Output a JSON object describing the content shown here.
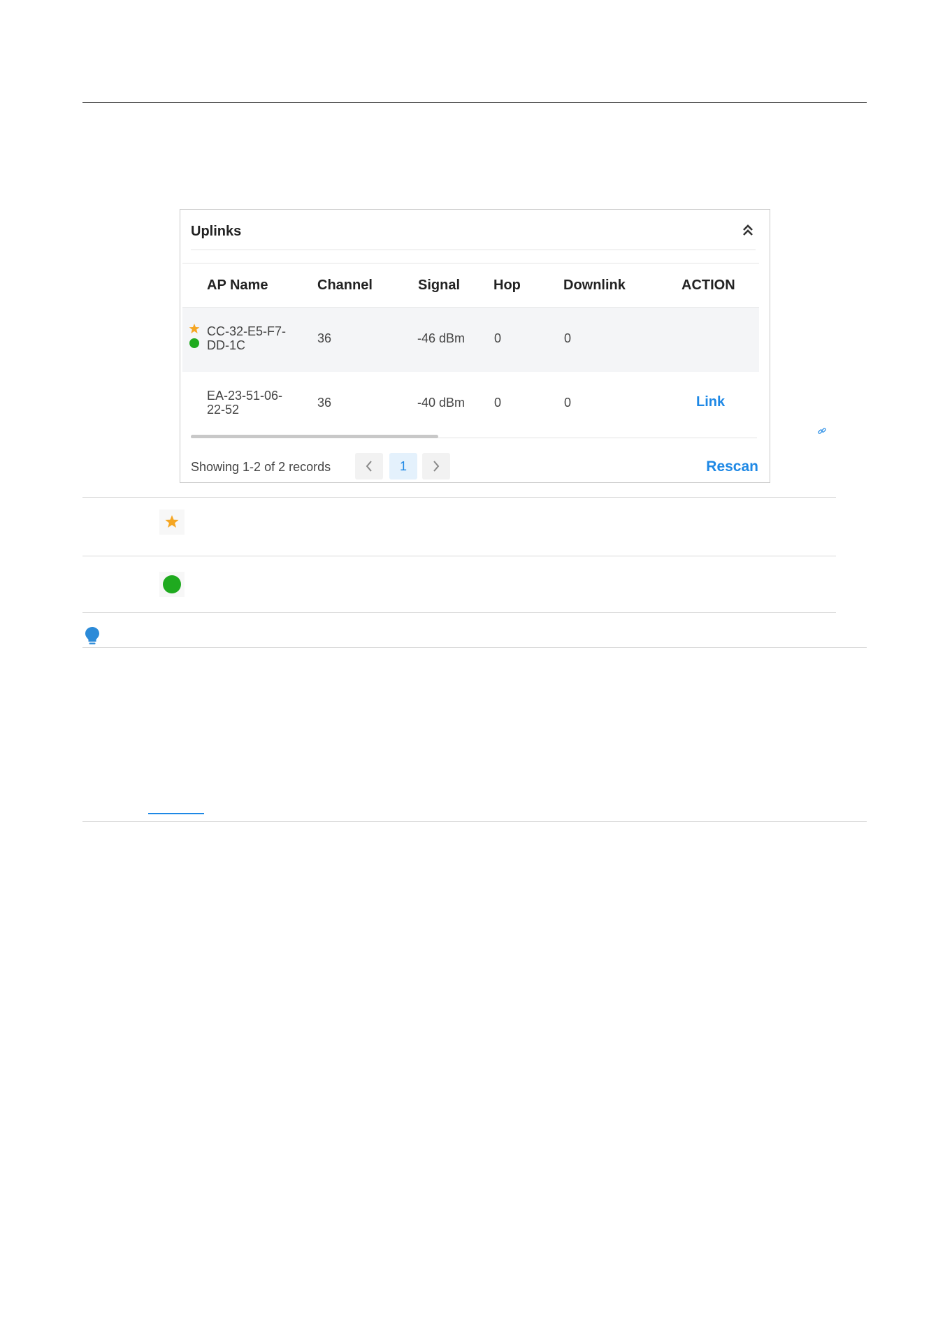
{
  "panel": {
    "title": "Uplinks",
    "columns": [
      "AP Name",
      "Channel",
      "Signal",
      "Hop",
      "Downlink",
      "ACTION"
    ],
    "rows": [
      {
        "ap_name": "CC-32-E5-F7-DD-1C",
        "channel": "36",
        "signal": "-46 dBm",
        "hop": "0",
        "downlink": "0",
        "action": "",
        "icons": [
          "star-icon",
          "green-dot-icon"
        ]
      },
      {
        "ap_name": "EA-23-51-06-22-52",
        "channel": "36",
        "signal": "-40 dBm",
        "hop": "0",
        "downlink": "0",
        "action": "Link",
        "icons": []
      }
    ],
    "records_text": "Showing 1-2 of 2 records",
    "current_page": "1",
    "rescan_label": "Rescan"
  },
  "colors": {
    "accent": "#1e88e5",
    "star": "#f5a623",
    "online": "#1faa1f",
    "tip": "#2b8ad8"
  },
  "icons": {
    "collapse": "double-chevron-up-icon",
    "prev": "chevron-left-icon",
    "next": "chevron-right-icon",
    "legend": [
      "star-icon",
      "green-dot-icon"
    ],
    "tip": "lightbulb-icon",
    "link": "link-icon"
  }
}
